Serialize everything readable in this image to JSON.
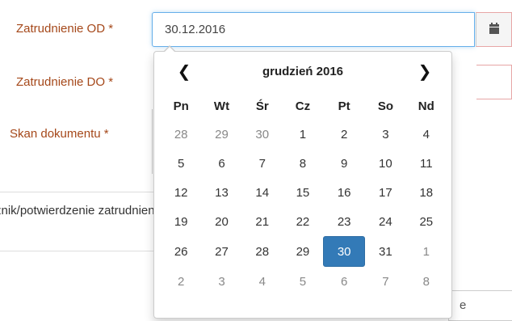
{
  "form": {
    "label_od": "Zatrudnienie OD *",
    "label_do": "Zatrudnienie DO *",
    "label_skan": "Skan dokumentu *",
    "date_od_value": "30.12.2016",
    "row_text": "znik/potwierdzenie zatrudnienia",
    "bottom_char": "e"
  },
  "icons": {
    "calendar": "calendar-icon",
    "prev": "chevron-left-icon",
    "next": "chevron-right-icon"
  },
  "colors": {
    "label": "#a5481a",
    "selected_day": "#337ab7",
    "input_focus": "#66afe9",
    "error_border": "#e7a6a6"
  },
  "datepicker": {
    "prev": "❮",
    "next": "❯",
    "title": "grudzień 2016",
    "weekdays": [
      "Pn",
      "Wt",
      "Śr",
      "Cz",
      "Pt",
      "So",
      "Nd"
    ],
    "weeks": [
      [
        "28",
        "29",
        "30",
        "1",
        "2",
        "3",
        "4"
      ],
      [
        "5",
        "6",
        "7",
        "8",
        "9",
        "10",
        "11"
      ],
      [
        "12",
        "13",
        "14",
        "15",
        "16",
        "17",
        "18"
      ],
      [
        "19",
        "20",
        "21",
        "22",
        "23",
        "24",
        "25"
      ],
      [
        "26",
        "27",
        "28",
        "29",
        "30",
        "31",
        "1"
      ],
      [
        "2",
        "3",
        "4",
        "5",
        "6",
        "7",
        "8"
      ]
    ],
    "selected": "30"
  }
}
